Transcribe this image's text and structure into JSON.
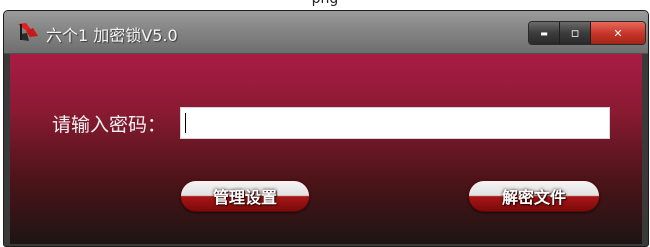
{
  "top_caption": "png",
  "window": {
    "title": "六个1 加密锁V5.0",
    "controls": {
      "minimize_glyph": "▬",
      "maximize_glyph": "▫",
      "close_glyph": "✕",
      "close_color": "#c8372a"
    }
  },
  "form": {
    "password_label": "请输入密码：",
    "password_value": "",
    "manage_button_label": "管理设置",
    "decrypt_button_label": "解密文件"
  },
  "colors": {
    "body_gradient_top": "#a91c45",
    "body_gradient_bottom": "#1e1414",
    "button_red": "#a81616"
  }
}
